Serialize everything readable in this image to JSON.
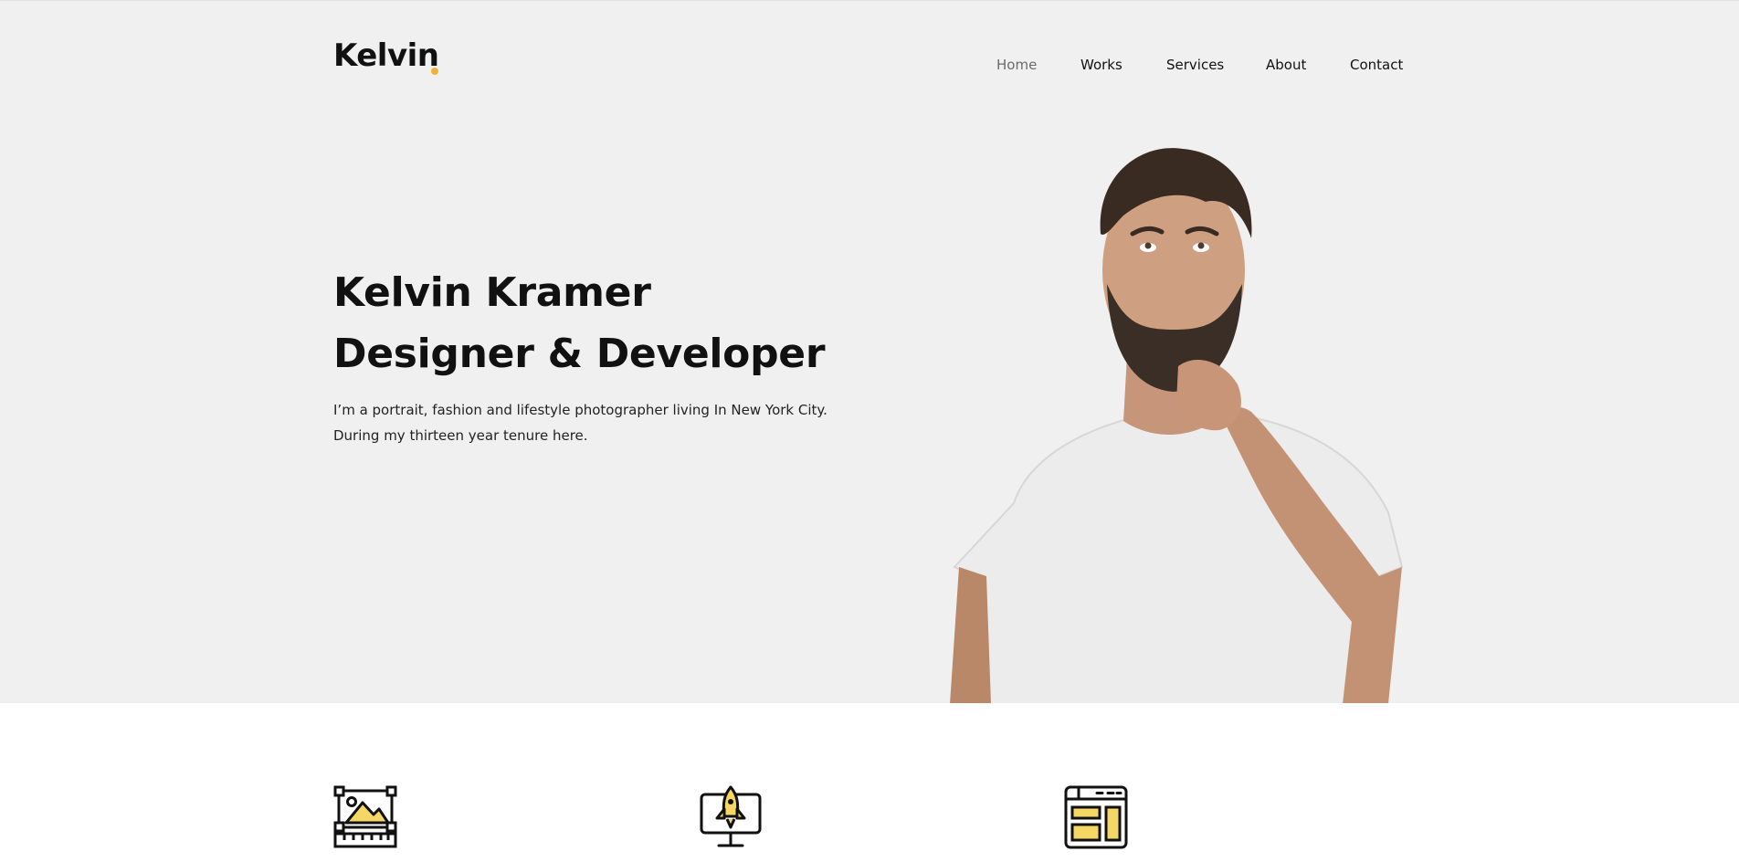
{
  "header": {
    "logo": "Kelvin",
    "nav": [
      {
        "label": "Home",
        "active": true
      },
      {
        "label": "Works",
        "active": false
      },
      {
        "label": "Services",
        "active": false
      },
      {
        "label": "About",
        "active": false
      },
      {
        "label": "Contact",
        "active": false
      }
    ]
  },
  "hero": {
    "title_line1": "Kelvin Kramer",
    "title_line2": "Designer & Developer",
    "text_line1": "I’m a portrait, fashion and lifestyle photographer living In New York City.",
    "text_line2": "During my thirteen year tenure here."
  },
  "services": {
    "icons": [
      "image-design-icon",
      "rocket-monitor-icon",
      "web-layout-icon"
    ]
  },
  "colors": {
    "accent": "#f2b134",
    "hero_bg": "#f1f0f0",
    "icon_fill": "#f5d766",
    "text": "#111111"
  }
}
